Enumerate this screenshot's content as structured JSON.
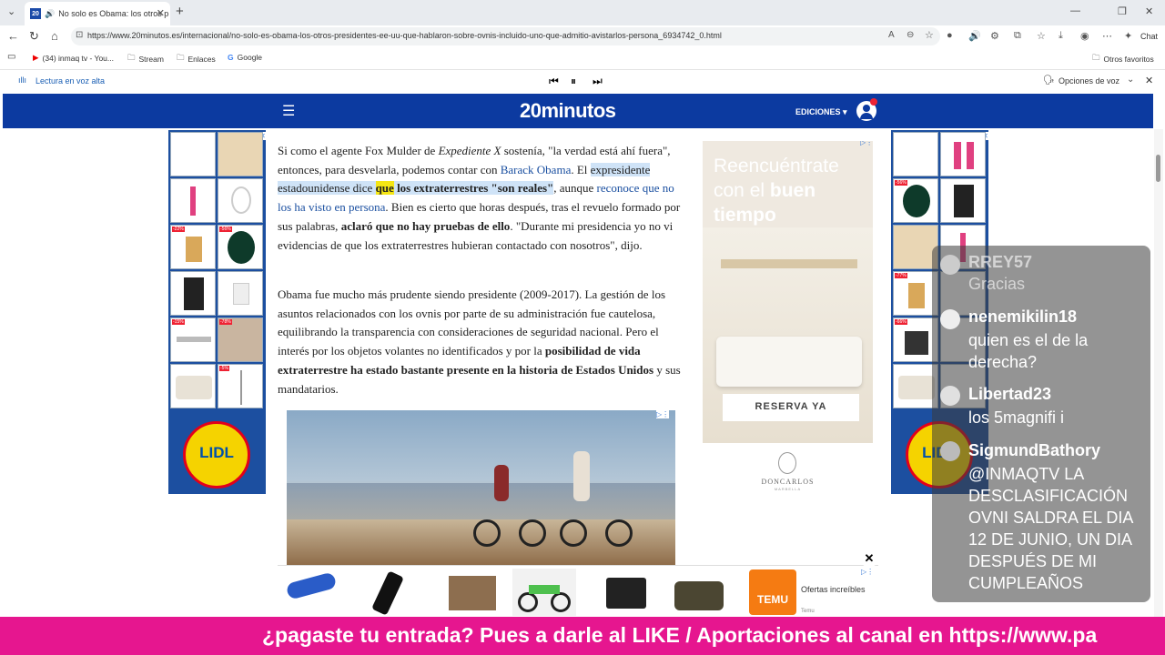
{
  "browser": {
    "tab_title": "No solo es Obama: los otros p",
    "favicon_text": "20",
    "url": "https://www.20minutos.es/internacional/no-solo-es-obama-los-otros-presidentes-ee-uu-que-hablaron-sobre-ovnis-incluido-uno-que-admitio-avistarlos-persona_6934742_0.html",
    "chat_label": "Chat"
  },
  "bookmarks": {
    "items": [
      "(34) inmaq tv - You...",
      "Stream",
      "Enlaces",
      "Google"
    ],
    "other": "Otros favoritos"
  },
  "read_aloud": {
    "label": "Lectura en voz alta",
    "voice_options": "Opciones de voz"
  },
  "site": {
    "logo": "20minutos",
    "editions": "EDICIONES"
  },
  "article": {
    "p1_a": "Si como el agente Fox Mulder de ",
    "p1_em": "Expediente X",
    "p1_b": " sostenía, \"la verdad está ahí fuera\", entonces, para desvelarla, podemos contar con ",
    "p1_link": "Barack Obama",
    "p1_c": ". El ",
    "p1_hl1": "expresidente estadounidense dice ",
    "p1_hly": "que",
    "p1_hl2": " los extraterrestres \"son reales\"",
    "p1_d": ", aunque ",
    "p1_link2": "reconoce que no los ha visto en persona",
    "p1_e": ". Bien es cierto que horas después, tras el revuelo formado por sus palabras, ",
    "p1_strong": "aclaró que no hay pruebas de ello",
    "p1_f": ". \"Durante mi presidencia yo no vi evidencias de que los extraterrestres hubieran contactado con nosotros\", dijo.",
    "p2_a": "Obama fue mucho más prudente siendo presidente (2009-2017). La gestión de los asuntos relacionados con los ovnis por parte de su administración fue cautelosa, equilibrando la transparencia con consideraciones de seguridad nacional. Pero el interés por los objetos volantes no identificados y por la ",
    "p2_strong": "posibilidad de vida extraterrestre ha estado bastante presente en la historia de Estados Unidos",
    "p2_b": " y sus mandatarios."
  },
  "ads": {
    "lidl_logo": "LIDL",
    "left_discounts": [
      "-22%",
      "-56%",
      "-15%",
      "-78%",
      "-5%"
    ],
    "right_discounts": [
      "-56%",
      "-77%",
      "-66%"
    ],
    "side_headline_a": "Reencuéntrate con el ",
    "side_headline_b": "buen tiempo",
    "side_cta": "RESERVA YA",
    "side_brand": "DONCARLOS",
    "side_brand_sub": "MARBELLA",
    "temu_label": "Ofertas increíbles",
    "temu_logo": "TEMU",
    "temu_sub": "Temu"
  },
  "chat": {
    "messages": [
      {
        "user": "RREY57",
        "text": "Gracias"
      },
      {
        "user": "nenemikilin18",
        "text": "quien es el de la derecha?"
      },
      {
        "user": "Libertad23",
        "text": "los 5magnifi i"
      },
      {
        "user": "SigmundBathory",
        "text": "@INMAQTV LA DESCLASIFICACIÓN OVNI SALDRA EL DIA 12 DE JUNIO, UN DIA DESPUÉS DE MI CUMPLEAÑOS"
      }
    ]
  },
  "ticker": "¿pagaste tu entrada? Pues a darle al LIKE / Aportaciones al canal en https://www.pa"
}
